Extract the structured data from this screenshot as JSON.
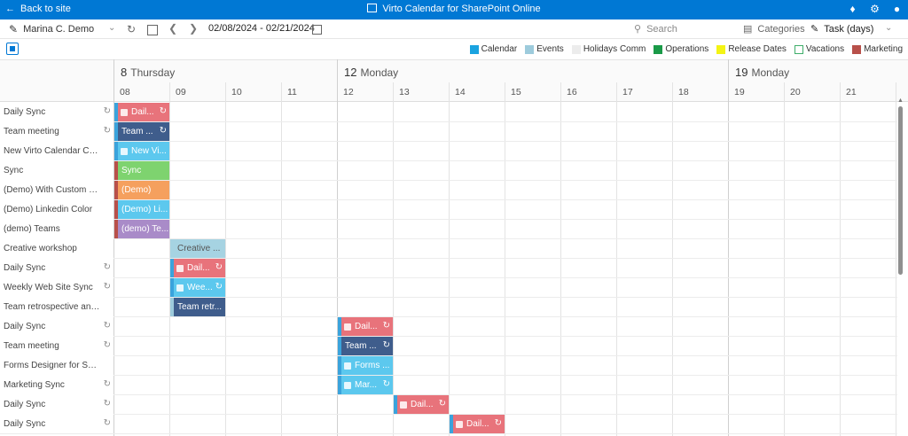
{
  "topbar": {
    "back_label": "Back to site",
    "title": "Virto Calendar for SharePoint Online"
  },
  "toolbar": {
    "user": "Marina C. Demo",
    "date_range": "02/08/2024 - 02/21/2024",
    "search_placeholder": "Search",
    "categories_label": "Categories",
    "view_label": "Task (days)"
  },
  "legend": [
    {
      "label": "Calendar",
      "color": "#1aa3e0",
      "outline": false
    },
    {
      "label": "Events",
      "color": "#9dcbdc",
      "outline": false
    },
    {
      "label": "Holidays Comm",
      "color": "#ececec",
      "outline": false
    },
    {
      "label": "Operations",
      "color": "#1a9a48",
      "outline": false
    },
    {
      "label": "Release Dates",
      "color": "#f4f414",
      "outline": false
    },
    {
      "label": "Vacations",
      "color": "#3fae6a",
      "outline": true
    },
    {
      "label": "Marketing",
      "color": "#b8504a",
      "outline": false
    }
  ],
  "days": [
    {
      "num": "8",
      "name": "Thursday"
    },
    {
      "num": "12",
      "name": "Monday"
    },
    {
      "num": "19",
      "name": "Monday"
    }
  ],
  "hours": [
    "08",
    "09",
    "10",
    "11",
    "12",
    "13",
    "14",
    "15",
    "16",
    "17",
    "18",
    "19",
    "20",
    "21"
  ],
  "rows": [
    {
      "label": "Daily Sync",
      "recurring": true
    },
    {
      "label": "Team meeting",
      "recurring": true
    },
    {
      "label": "New Virto Calendar Categ...",
      "recurring": false
    },
    {
      "label": "Sync",
      "recurring": false
    },
    {
      "label": "(Demo) With Custom Color",
      "recurring": false
    },
    {
      "label": "(Demo) Linkedin Color",
      "recurring": false
    },
    {
      "label": "(demo) Teams",
      "recurring": false
    },
    {
      "label": "Creative workshop",
      "recurring": false
    },
    {
      "label": "Daily Sync",
      "recurring": true
    },
    {
      "label": "Weekly Web Site Sync",
      "recurring": true
    },
    {
      "label": "Team retrospective and pl...",
      "recurring": false
    },
    {
      "label": "Daily Sync",
      "recurring": true
    },
    {
      "label": "Team meeting",
      "recurring": true
    },
    {
      "label": "Forms Designer for Share...",
      "recurring": false
    },
    {
      "label": "Marketing Sync",
      "recurring": true
    },
    {
      "label": "Daily Sync",
      "recurring": true
    },
    {
      "label": "Daily Sync",
      "recurring": true
    }
  ],
  "events": [
    {
      "row": 0,
      "col": 0,
      "label": "Dail...",
      "color": "#e8737b",
      "edge": "#3aa3dc",
      "teams": true,
      "recurring": true
    },
    {
      "row": 1,
      "col": 0,
      "label": "Team ...",
      "color": "#3f5d8c",
      "edge": "#3aa3dc",
      "teams": false,
      "recurring": true
    },
    {
      "row": 2,
      "col": 0,
      "label": "New Vi...",
      "color": "#5cc8ee",
      "edge": "#3aa3dc",
      "teams": true,
      "recurring": false
    },
    {
      "row": 3,
      "col": 0,
      "label": "Sync",
      "color": "#7ed36f",
      "edge": "#b8504a",
      "teams": false,
      "recurring": false
    },
    {
      "row": 4,
      "col": 0,
      "label": "(Demo)",
      "color": "#f5a05e",
      "edge": "#b8504a",
      "teams": false,
      "recurring": false
    },
    {
      "row": 5,
      "col": 0,
      "label": "(Demo) Li...",
      "color": "#5cc8ee",
      "edge": "#b8504a",
      "teams": false,
      "recurring": false
    },
    {
      "row": 6,
      "col": 0,
      "label": "(demo) Te...",
      "color": "#a98bc8",
      "edge": "#b8504a",
      "teams": false,
      "recurring": false
    },
    {
      "row": 7,
      "col": 1,
      "label": "Creative ...",
      "color": "#a6d3e2",
      "edge": "#a6d3e2",
      "teams": false,
      "recurring": false,
      "dark": true
    },
    {
      "row": 8,
      "col": 1,
      "label": "Dail...",
      "color": "#e8737b",
      "edge": "#3aa3dc",
      "teams": true,
      "recurring": true
    },
    {
      "row": 9,
      "col": 1,
      "label": "Wee...",
      "color": "#5cc8ee",
      "edge": "#3aa3dc",
      "teams": true,
      "recurring": true
    },
    {
      "row": 10,
      "col": 1,
      "label": "Team retr...",
      "color": "#3f5d8c",
      "edge": "#9dcbdc",
      "teams": false,
      "recurring": false
    },
    {
      "row": 11,
      "col": 4,
      "label": "Dail...",
      "color": "#e8737b",
      "edge": "#3aa3dc",
      "teams": true,
      "recurring": true
    },
    {
      "row": 12,
      "col": 4,
      "label": "Team ...",
      "color": "#3f5d8c",
      "edge": "#3aa3dc",
      "teams": false,
      "recurring": true
    },
    {
      "row": 13,
      "col": 4,
      "label": "Forms ...",
      "color": "#5cc8ee",
      "edge": "#3aa3dc",
      "teams": true,
      "recurring": false
    },
    {
      "row": 14,
      "col": 4,
      "label": "Mar...",
      "color": "#5cc8ee",
      "edge": "#3aa3dc",
      "teams": true,
      "recurring": true
    },
    {
      "row": 15,
      "col": 5,
      "label": "Dail...",
      "color": "#e8737b",
      "edge": "#3aa3dc",
      "teams": true,
      "recurring": true
    },
    {
      "row": 16,
      "col": 6,
      "label": "Dail...",
      "color": "#e8737b",
      "edge": "#3aa3dc",
      "teams": true,
      "recurring": true
    }
  ]
}
